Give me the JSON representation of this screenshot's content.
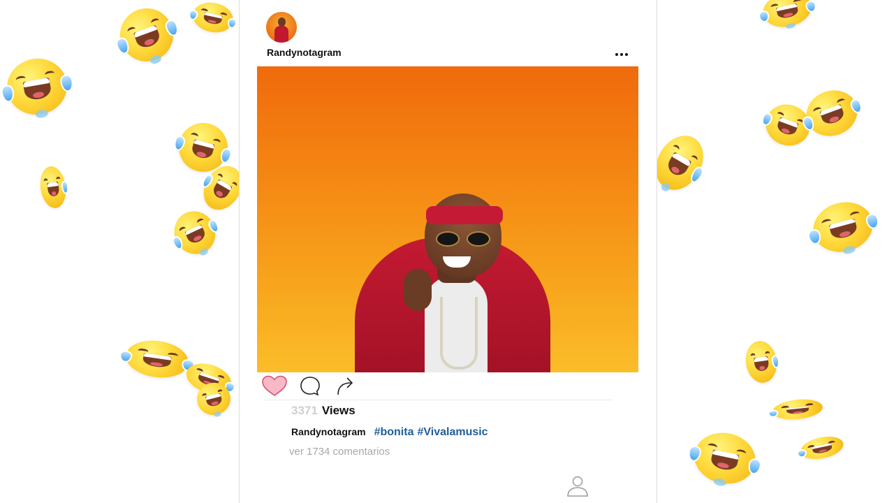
{
  "post": {
    "username": "Randynotagram",
    "views_count": "3371",
    "views_label": "Views",
    "caption_user": "Randynotagram",
    "hashtags": [
      "#bonita",
      "#Vivalamusic"
    ],
    "comments_link": "ver 1734 comentarios"
  },
  "icons": {
    "more": "more-options-icon",
    "like": "heart-icon",
    "comment": "comment-bubble-icon",
    "share": "share-arrow-icon",
    "profile": "user-profile-icon",
    "background_emoji": "tears-of-joy-emoji"
  },
  "colors": {
    "photo_gradient_top": "#f06a0c",
    "photo_gradient_bottom": "#fbbd2a",
    "like_fill": "#f7b9c8",
    "hashtag": "#1f5e9a",
    "views_count": "#cfcfcf",
    "comments_link": "#a8a8a8"
  }
}
